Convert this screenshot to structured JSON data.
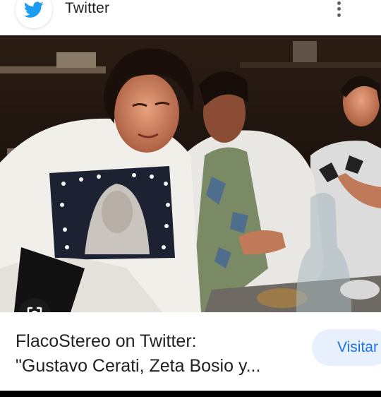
{
  "header": {
    "source_name": "Twitter",
    "brand_color": "#1d9bf0",
    "more_icon": "more-vert-icon",
    "source_icon": "twitter-bird-icon"
  },
  "image": {
    "lens_icon": "google-lens-icon"
  },
  "result": {
    "title_line1": "FlacoStereo on Twitter:",
    "title_line2": "\"Gustavo Cerati, Zeta Bosio y...",
    "visit_label": "Visitar"
  }
}
